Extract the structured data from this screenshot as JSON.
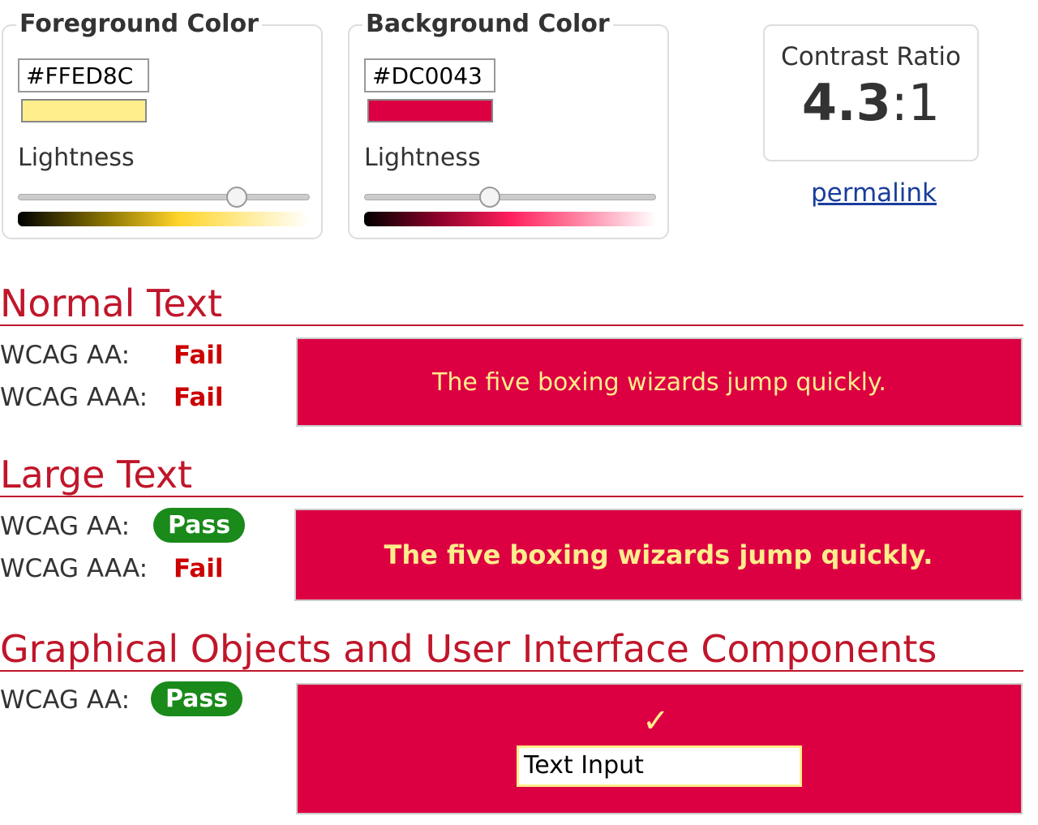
{
  "foreground": {
    "legend": "Foreground Color",
    "hex": "#FFED8C",
    "color": "#FFED8C",
    "lightness_label": "Lightness",
    "lightness_percent": 75
  },
  "background": {
    "legend": "Background Color",
    "hex": "#DC0043",
    "color": "#DC0043",
    "lightness_label": "Lightness",
    "lightness_percent": 43
  },
  "contrast": {
    "title": "Contrast Ratio",
    "value": "4.3",
    "suffix": ":1",
    "permalink": "permalink"
  },
  "normal": {
    "heading": "Normal Text",
    "aa_label": "WCAG AA:",
    "aa": "Fail",
    "aaa_label": "WCAG AAA:",
    "aaa": "Fail",
    "sample": "The five boxing wizards jump quickly."
  },
  "large": {
    "heading": "Large Text",
    "aa_label": "WCAG AA:",
    "aa": "Pass",
    "aaa_label": "WCAG AAA:",
    "aaa": "Fail",
    "sample": "The five boxing wizards jump quickly."
  },
  "graphical": {
    "heading": "Graphical Objects and User Interface Components",
    "aa_label": "WCAG AA:",
    "aa": "Pass",
    "check": "✓",
    "input_value": "Text Input"
  },
  "colors": {
    "heading": "#C0162A",
    "pass": "#1A8A1A",
    "fail": "#CC0000",
    "link": "#1A3D9C"
  }
}
